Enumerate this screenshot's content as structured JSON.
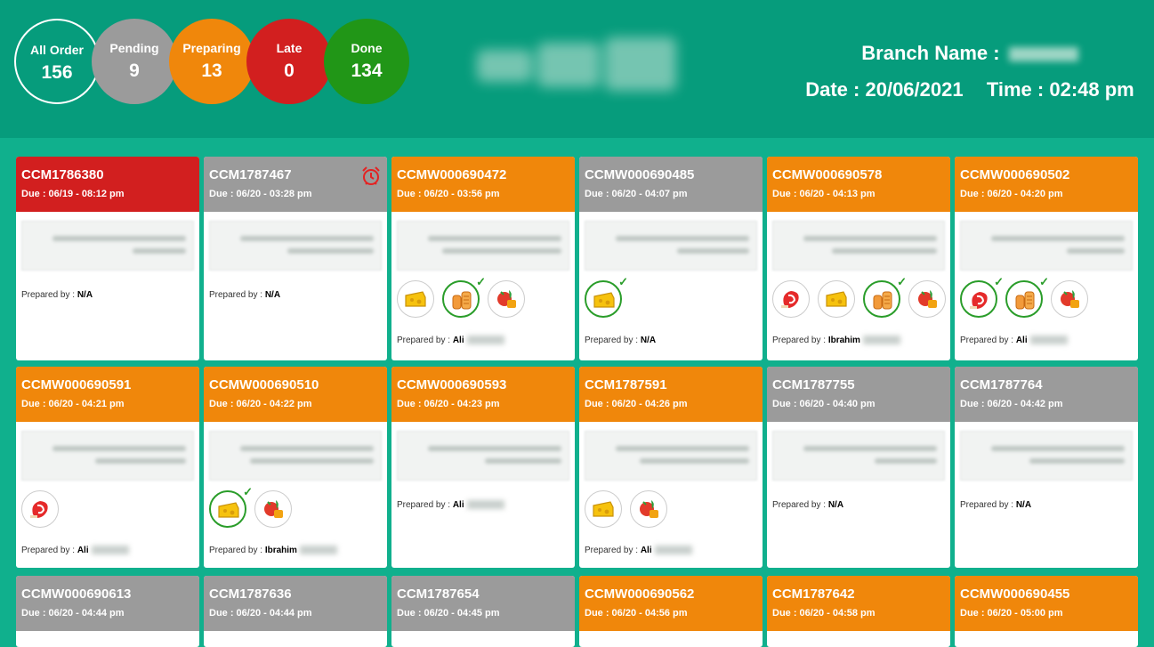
{
  "stats": [
    {
      "label": "All Order",
      "value": "156",
      "color": "#069c7c"
    },
    {
      "label": "Pending",
      "value": "9",
      "color": "#9b9b9b"
    },
    {
      "label": "Preparing",
      "value": "13",
      "color": "#f0870b"
    },
    {
      "label": "Late",
      "value": "0",
      "color": "#d21f1f"
    },
    {
      "label": "Done",
      "value": "134",
      "color": "#219617"
    }
  ],
  "header": {
    "branch_label": "Branch Name :",
    "date_label": "Date :",
    "date": "20/06/2021",
    "time_label": "Time :",
    "time": "02:48 pm"
  },
  "prepared_label": "Prepared by :",
  "colors": {
    "late": "#d21f1f",
    "pending": "#9b9b9b",
    "preparing": "#f0870b",
    "background": "#10b08d",
    "topbar": "#069c7c"
  },
  "orders": [
    {
      "code": "CCM1786380",
      "due": "Due : 06/19 - 08:12 pm",
      "status": "late",
      "prepared_by": "N/A",
      "items": []
    },
    {
      "code": "CCM1787467",
      "due": "Due : 06/20 - 03:28 pm",
      "status": "pending",
      "prepared_by": "N/A",
      "items": [],
      "alarm": true
    },
    {
      "code": "CCMW000690472",
      "due": "Due : 06/20 - 03:56 pm",
      "status": "preparing",
      "prepared_by": "Ali",
      "items": [
        {
          "icon": "cheese-icon",
          "done": false
        },
        {
          "icon": "bread-icon",
          "done": true
        },
        {
          "icon": "vegetables-icon",
          "done": false
        }
      ]
    },
    {
      "code": "CCMW000690485",
      "due": "Due : 06/20 - 04:07 pm",
      "status": "pending",
      "prepared_by": "N/A",
      "items": [
        {
          "icon": "cheese-icon",
          "done": true
        }
      ]
    },
    {
      "code": "CCMW000690578",
      "due": "Due : 06/20 - 04:13 pm",
      "status": "preparing",
      "prepared_by": "Ibrahim",
      "items": [
        {
          "icon": "meat-icon",
          "done": false
        },
        {
          "icon": "cheese-icon",
          "done": false
        },
        {
          "icon": "bread-icon",
          "done": true
        },
        {
          "icon": "vegetables-icon",
          "done": false
        }
      ]
    },
    {
      "code": "CCMW000690502",
      "due": "Due : 06/20 - 04:20 pm",
      "status": "preparing",
      "prepared_by": "Ali",
      "items": [
        {
          "icon": "meat-icon",
          "done": true
        },
        {
          "icon": "bread-icon",
          "done": true
        },
        {
          "icon": "vegetables-icon",
          "done": false
        }
      ]
    },
    {
      "code": "CCMW000690591",
      "due": "Due : 06/20 - 04:21 pm",
      "status": "preparing",
      "prepared_by": "Ali",
      "items": [
        {
          "icon": "meat-icon",
          "done": false
        }
      ]
    },
    {
      "code": "CCMW000690510",
      "due": "Due : 06/20 - 04:22 pm",
      "status": "preparing",
      "prepared_by": "Ibrahim",
      "items": [
        {
          "icon": "cheese-icon",
          "done": true
        },
        {
          "icon": "vegetables-icon",
          "done": false
        }
      ]
    },
    {
      "code": "CCMW000690593",
      "due": "Due : 06/20 - 04:23 pm",
      "status": "preparing",
      "prepared_by": "Ali",
      "items": []
    },
    {
      "code": "CCM1787591",
      "due": "Due : 06/20 - 04:26 pm",
      "status": "preparing",
      "prepared_by": "Ali",
      "items": [
        {
          "icon": "cheese-icon",
          "done": false
        },
        {
          "icon": "vegetables-icon",
          "done": false
        }
      ]
    },
    {
      "code": "CCM1787755",
      "due": "Due : 06/20 - 04:40 pm",
      "status": "pending",
      "prepared_by": "N/A",
      "items": []
    },
    {
      "code": "CCM1787764",
      "due": "Due : 06/20 - 04:42 pm",
      "status": "pending",
      "prepared_by": "N/A",
      "items": []
    },
    {
      "code": "CCMW000690613",
      "due": "Due : 06/20 - 04:44 pm",
      "status": "pending",
      "prepared_by": "",
      "items": []
    },
    {
      "code": "CCM1787636",
      "due": "Due : 06/20 - 04:44 pm",
      "status": "pending",
      "prepared_by": "",
      "items": []
    },
    {
      "code": "CCM1787654",
      "due": "Due : 06/20 - 04:45 pm",
      "status": "pending",
      "prepared_by": "",
      "items": []
    },
    {
      "code": "CCMW000690562",
      "due": "Due : 06/20 - 04:56 pm",
      "status": "preparing",
      "prepared_by": "",
      "items": []
    },
    {
      "code": "CCM1787642",
      "due": "Due : 06/20 - 04:58 pm",
      "status": "preparing",
      "prepared_by": "",
      "items": []
    },
    {
      "code": "CCMW000690455",
      "due": "Due : 06/20 - 05:00 pm",
      "status": "preparing",
      "prepared_by": "",
      "items": []
    }
  ]
}
